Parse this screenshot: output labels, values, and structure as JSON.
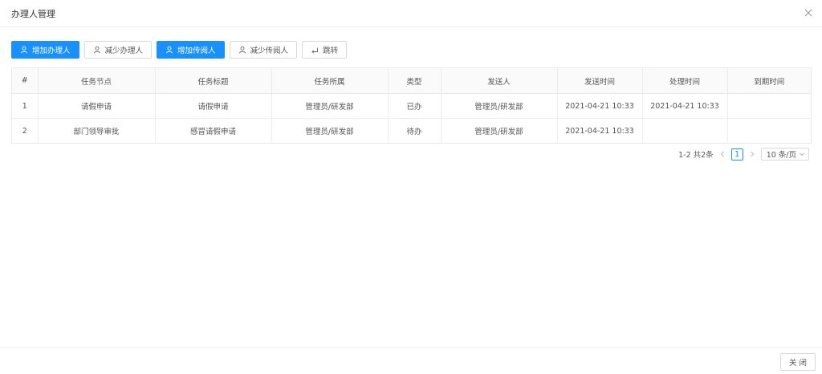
{
  "header": {
    "title": "办理人管理"
  },
  "toolbar": {
    "add_handler": "增加办理人",
    "remove_handler": "减少办理人",
    "add_reader": "增加传阅人",
    "remove_reader": "减少传阅人",
    "jump": "跳转"
  },
  "table": {
    "columns": [
      "#",
      "任务节点",
      "任务标题",
      "任务所属",
      "类型",
      "发送人",
      "发送时间",
      "处理时间",
      "到期时间"
    ],
    "rows": [
      [
        "1",
        "请假申请",
        "请假申请",
        "管理员/研发部",
        "已办",
        "管理员/研发部",
        "2021-04-21 10:33",
        "2021-04-21 10:33",
        ""
      ],
      [
        "2",
        "部门领导审批",
        "感冒请假申请",
        "管理员/研发部",
        "待办",
        "管理员/研发部",
        "2021-04-21 10:33",
        "",
        ""
      ]
    ]
  },
  "pagination": {
    "total_text": "1-2 共2条",
    "current_page": "1",
    "page_size": "10 条/页"
  },
  "footer": {
    "close_label": "关 闭"
  },
  "colors": {
    "primary": "#1890ff"
  }
}
